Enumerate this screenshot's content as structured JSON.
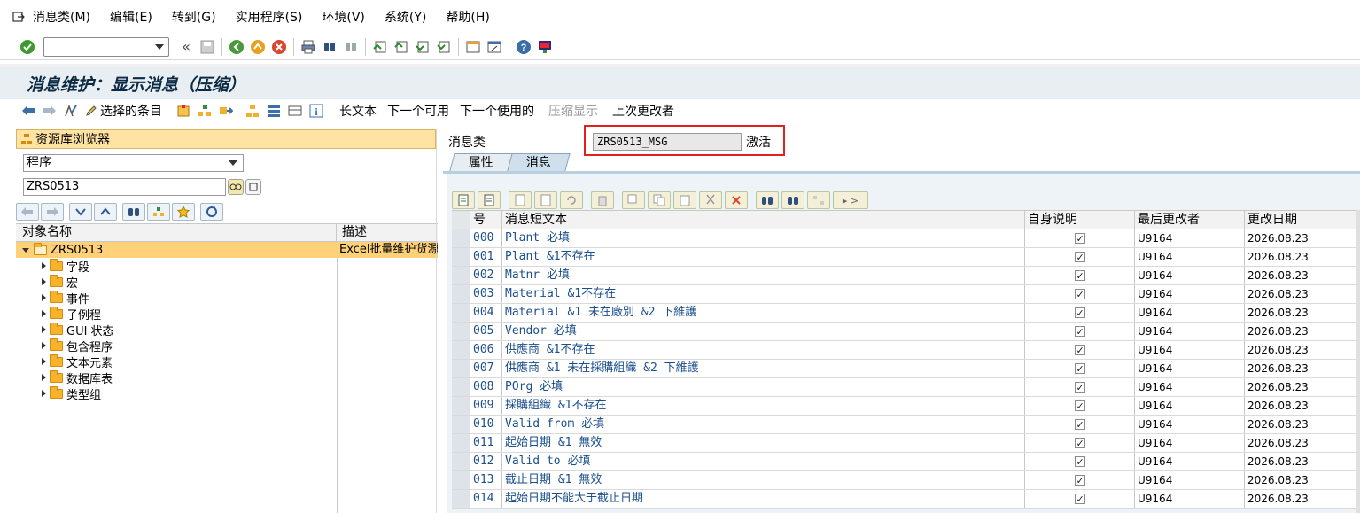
{
  "menubar": {
    "items": [
      "消息类(M)",
      "编辑(E)",
      "转到(G)",
      "实用程序(S)",
      "环境(V)",
      "系统(Y)",
      "帮助(H)"
    ]
  },
  "toolbar": {
    "command_value": "",
    "icons": [
      "enter-icon",
      "back-icon",
      "save-icon",
      "green-back-icon",
      "exit-icon",
      "cancel-icon",
      "print-icon",
      "find-icon",
      "find-next-icon",
      "first-page-icon",
      "prev-page-icon",
      "next-page-icon",
      "last-page-icon",
      "new-session-icon",
      "shortcut-icon",
      "help-icon",
      "customize-icon"
    ]
  },
  "title": "消息维护：显示消息（压缩）",
  "app_toolbar": {
    "selected_entries": "选择的条目",
    "long_text": "长文本",
    "next_available": "下一个可用",
    "next_used": "下一个使用的",
    "compressed_display": "压缩显示",
    "last_changed_by": "上次更改者"
  },
  "repository": {
    "header": "资源库浏览器",
    "object_type": "程序",
    "object_name": "ZRS0513",
    "tree_columns": [
      "对象名称",
      "描述"
    ],
    "root": {
      "name": "ZRS0513",
      "desc": "Excel批量维护货源"
    },
    "children": [
      "字段",
      "宏",
      "事件",
      "子例程",
      "GUI 状态",
      "包含程序",
      "文本元素",
      "数据库表",
      "类型组"
    ]
  },
  "message_class": {
    "label": "消息类",
    "value": "ZRS0513_MSG",
    "status": "激活"
  },
  "tabs": [
    "属性",
    "消息"
  ],
  "grid": {
    "columns": [
      "号",
      "消息短文本",
      "自身说明",
      "最后更改者",
      "更改日期"
    ],
    "rows": [
      {
        "num": "000",
        "text": "Plant 必填",
        "self": true,
        "user": "U9164",
        "date": "2026.08.23"
      },
      {
        "num": "001",
        "text": "Plant &1不存在",
        "self": true,
        "user": "U9164",
        "date": "2026.08.23"
      },
      {
        "num": "002",
        "text": "Matnr 必填",
        "self": true,
        "user": "U9164",
        "date": "2026.08.23"
      },
      {
        "num": "003",
        "text": "Material &1不存在",
        "self": true,
        "user": "U9164",
        "date": "2026.08.23"
      },
      {
        "num": "004",
        "text": "Material &1 未在廠別 &2 下維護",
        "self": true,
        "user": "U9164",
        "date": "2026.08.23"
      },
      {
        "num": "005",
        "text": "Vendor 必填",
        "self": true,
        "user": "U9164",
        "date": "2026.08.23"
      },
      {
        "num": "006",
        "text": "供應商 &1不存在",
        "self": true,
        "user": "U9164",
        "date": "2026.08.23"
      },
      {
        "num": "007",
        "text": "供應商 &1 未在採購組織 &2 下維護",
        "self": true,
        "user": "U9164",
        "date": "2026.08.23"
      },
      {
        "num": "008",
        "text": "POrg 必填",
        "self": true,
        "user": "U9164",
        "date": "2026.08.23"
      },
      {
        "num": "009",
        "text": "採購組織 &1不存在",
        "self": true,
        "user": "U9164",
        "date": "2026.08.23"
      },
      {
        "num": "010",
        "text": "Valid from 必填",
        "self": true,
        "user": "U9164",
        "date": "2026.08.23"
      },
      {
        "num": "011",
        "text": "起始日期 &1 無效",
        "self": true,
        "user": "U9164",
        "date": "2026.08.23"
      },
      {
        "num": "012",
        "text": "Valid to 必填",
        "self": true,
        "user": "U9164",
        "date": "2026.08.23"
      },
      {
        "num": "013",
        "text": "截止日期 &1 無效",
        "self": true,
        "user": "U9164",
        "date": "2026.08.23"
      },
      {
        "num": "014",
        "text": "起始日期不能大于截止日期",
        "self": true,
        "user": "U9164",
        "date": "2026.08.23"
      }
    ]
  },
  "colors": {
    "title_bg": "#e8eef2",
    "repo_header_bg": "#ffe3a3",
    "selected_row": "#ffd27a",
    "highlight_border": "#e0221e",
    "message_text": "#1a4e8c"
  }
}
